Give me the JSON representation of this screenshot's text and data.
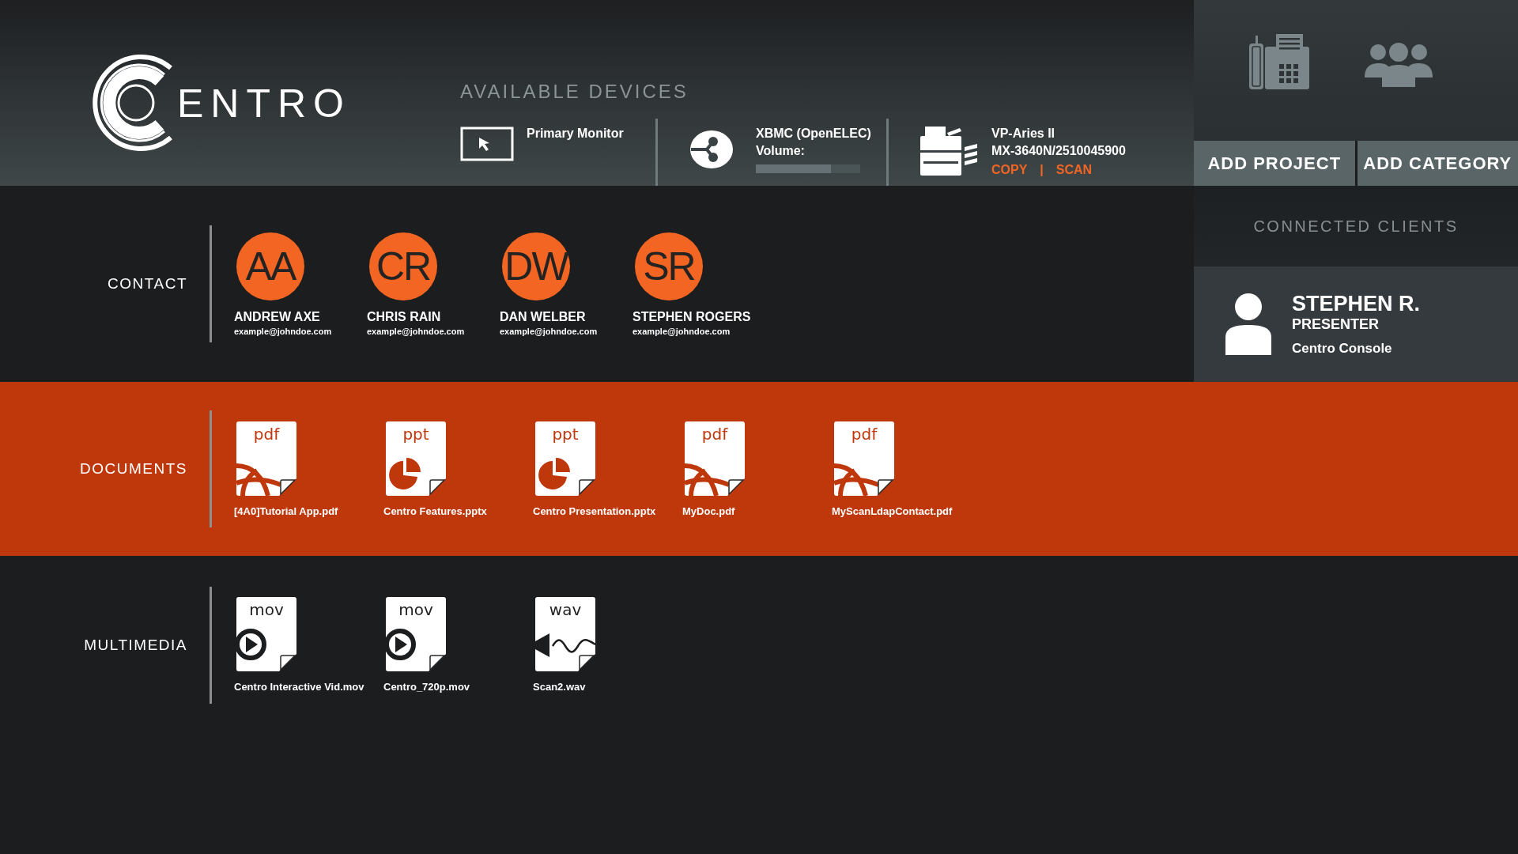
{
  "logo": {
    "text": "ENTRO"
  },
  "devices": {
    "title": "AVAILABLE DEVICES",
    "items": [
      {
        "kind": "monitor",
        "name": "Primary Monitor"
      },
      {
        "kind": "media",
        "name": "XBMC (OpenELEC)",
        "volume_label": "Volume:",
        "level": 0.72
      },
      {
        "kind": "printer",
        "name": "VP-Aries II",
        "model": "MX-3640N/2510045900",
        "actions": [
          "COPY",
          "SCAN"
        ],
        "separator": "|"
      }
    ]
  },
  "toolbar": {
    "buttons": [
      "ADD PROJECT",
      "ADD CATEGORY"
    ]
  },
  "connected_clients": {
    "title": "CONNECTED CLIENTS",
    "clients": [
      {
        "name": "STEPHEN R.",
        "role": "PRESENTER",
        "device": "Centro Console"
      }
    ]
  },
  "contacts": {
    "title": "CONTACT",
    "items": [
      {
        "initials": "AA",
        "name": "ANDREW AXE",
        "email": "example@johndoe.com"
      },
      {
        "initials": "CR",
        "name": "CHRIS RAIN",
        "email": "example@johndoe.com"
      },
      {
        "initials": "DW",
        "name": "DAN WELBER",
        "email": "example@johndoe.com"
      },
      {
        "initials": "SR",
        "name": "STEPHEN ROGERS",
        "email": "example@johndoe.com"
      }
    ]
  },
  "file_sections": [
    {
      "title": "DOCUMENTS",
      "highlighted": true,
      "files": [
        {
          "kind": "pdf",
          "type": "pdf",
          "name": "[4A0]Tutorial App.pdf"
        },
        {
          "kind": "ppt",
          "type": "ppt",
          "name": "Centro Features.pptx"
        },
        {
          "kind": "ppt",
          "type": "ppt",
          "name": "Centro Presentation.pptx"
        },
        {
          "kind": "pdf",
          "type": "pdf",
          "name": "MyDoc.pdf"
        },
        {
          "kind": "pdf",
          "type": "pdf",
          "name": "MyScanLdapContact.pdf"
        }
      ]
    },
    {
      "title": "MULTIMEDIA",
      "highlighted": false,
      "files": [
        {
          "kind": "video",
          "type": "mov",
          "name": "Centro Interactive Vid.mov"
        },
        {
          "kind": "video",
          "type": "mov",
          "name": "Centro_720p.mov"
        },
        {
          "kind": "audio",
          "type": "wav",
          "name": "Scan2.wav"
        }
      ]
    }
  ]
}
